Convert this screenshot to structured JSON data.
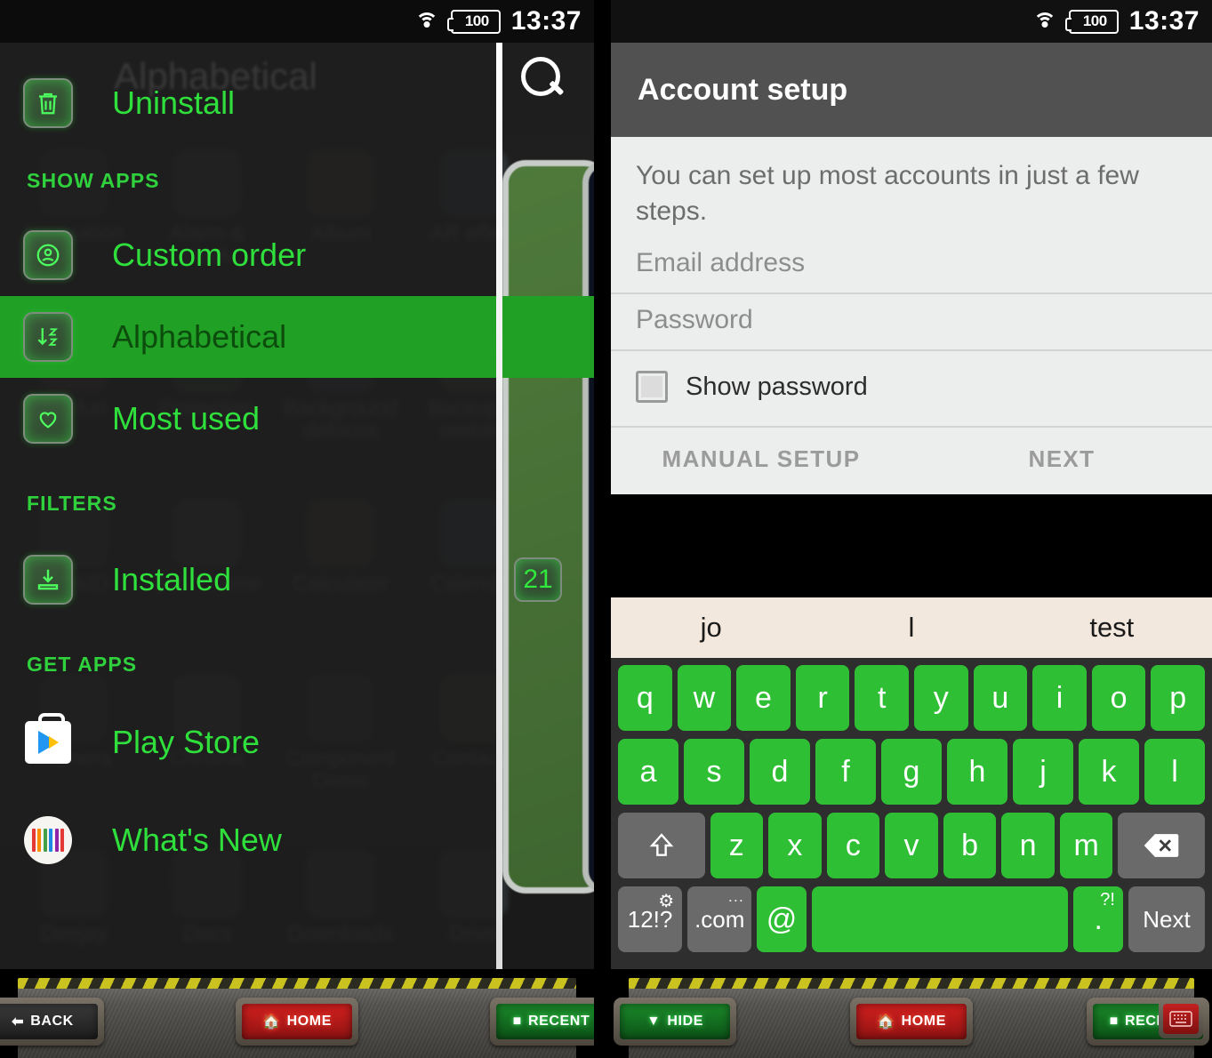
{
  "status_bar": {
    "wifi_icon": "wifi-icon",
    "battery_icon": "battery-icon",
    "battery_level": "100",
    "time": "13:37"
  },
  "left_panel": {
    "ghost_title": "Alphabetical",
    "search_icon": "search-icon",
    "uninstall": {
      "label": "Uninstall",
      "icon": "trash-icon"
    },
    "sections": [
      {
        "heading": "SHOW APPS",
        "items": [
          {
            "label": "Custom order",
            "icon": "person-badge-icon",
            "selected": false,
            "badge": ""
          },
          {
            "label": "Alphabetical",
            "icon": "sort-az-icon",
            "selected": true,
            "badge": ""
          },
          {
            "label": "Most used",
            "icon": "heart-icon",
            "selected": false,
            "badge": ""
          }
        ]
      },
      {
        "heading": "FILTERS",
        "items": [
          {
            "label": "Installed",
            "icon": "download-tray-icon",
            "selected": false,
            "badge": "21"
          }
        ]
      },
      {
        "heading": "GET APPS",
        "items": [
          {
            "label": "Play Store",
            "icon": "play-store-icon",
            "selected": false,
            "badge": ""
          },
          {
            "label": "What's New",
            "icon": "whats-new-icon",
            "selected": false,
            "badge": ""
          }
        ]
      }
    ],
    "background_apps": [
      "Navigation",
      "Alarm & clock",
      "Album",
      "AR effect",
      "AR fun",
      "Protection",
      "Background defocus",
      "Backup & restore",
      "BankID",
      "Box Theme",
      "Calculator",
      "Calendar",
      "Camera",
      "Chrome",
      "Component Demo",
      "Contacts",
      "Deejay",
      "Docs",
      "Downloads",
      "Drive"
    ],
    "card_labels": [
      "AR effect",
      "Backup & restore",
      "Calendar",
      "Contacts",
      "Drive"
    ],
    "navbar": [
      {
        "label": "BACK",
        "style": "dark",
        "glyph": "back-arrow-icon"
      },
      {
        "label": "HOME",
        "style": "red",
        "glyph": "home-icon"
      },
      {
        "label": "RECENT",
        "style": "green",
        "glyph": "square-icon"
      }
    ]
  },
  "right_panel": {
    "app_bar_title": "Account setup",
    "intro_text": "You can set up most accounts in just a few steps.",
    "email_field": {
      "placeholder": "Email address",
      "value": ""
    },
    "password_field": {
      "placeholder": "Password",
      "value": ""
    },
    "show_password": {
      "label": "Show password",
      "checked": false
    },
    "actions": {
      "manual_setup": "MANUAL SETUP",
      "next": "NEXT"
    },
    "keyboard": {
      "suggestions": [
        "jo",
        "l",
        "test"
      ],
      "row1": [
        "q",
        "w",
        "e",
        "r",
        "t",
        "y",
        "u",
        "i",
        "o",
        "p"
      ],
      "row2": [
        "a",
        "s",
        "d",
        "f",
        "g",
        "h",
        "j",
        "k",
        "l"
      ],
      "row3_letters": [
        "z",
        "x",
        "c",
        "v",
        "b",
        "n",
        "m"
      ],
      "shift_key": "shift-icon",
      "backspace_key": "backspace-icon",
      "symbols_key": "12!?",
      "settings_icon": "gear-icon",
      "dotcom_key": ".com",
      "dotcom_more": "···",
      "at_key": "@",
      "space_key": "",
      "period_key": ".",
      "period_sup": "?!",
      "enter_key": "Next"
    },
    "navbar": [
      {
        "label": "HIDE",
        "style": "green",
        "glyph": "chevron-down-icon"
      },
      {
        "label": "HOME",
        "style": "red",
        "glyph": "home-icon"
      },
      {
        "label": "RECENT",
        "style": "green",
        "glyph": "square-icon"
      }
    ],
    "keyboard_toggle_icon": "keyboard-icon"
  },
  "colors": {
    "accent_green": "#2fe03c",
    "key_green": "#2fbf35",
    "selected_row": "#21a026",
    "suggestion_bg": "#f3e8dd"
  }
}
